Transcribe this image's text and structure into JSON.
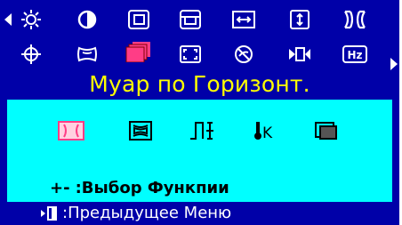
{
  "menu": {
    "title": "Муар по Горизонт.",
    "icons_row1": [
      "brightness-icon",
      "contrast-icon",
      "h-position-icon",
      "v-position-icon",
      "h-size-icon",
      "v-size-icon",
      "pincushion-icon"
    ],
    "icons_row2": [
      "rotation-icon",
      "trapezoid-icon",
      "moire-icon",
      "zoom-icon",
      "degauss-icon",
      "recall-icon",
      "frequency-icon"
    ],
    "selected": "moire-icon"
  },
  "submenu": {
    "icons": [
      "h-moire-icon",
      "v-moire-icon",
      "sharpness-icon",
      "color-temp-icon",
      "osd-position-icon"
    ],
    "hint_keys": "+-",
    "hint_text": ":Выбор Функпии"
  },
  "footer": {
    "text": ":Предыдущее Меню"
  },
  "colors": {
    "background": "#0000a8",
    "title": "#ffff00",
    "submenu_bg": "#00ffff",
    "selected": "#ff3d86"
  }
}
